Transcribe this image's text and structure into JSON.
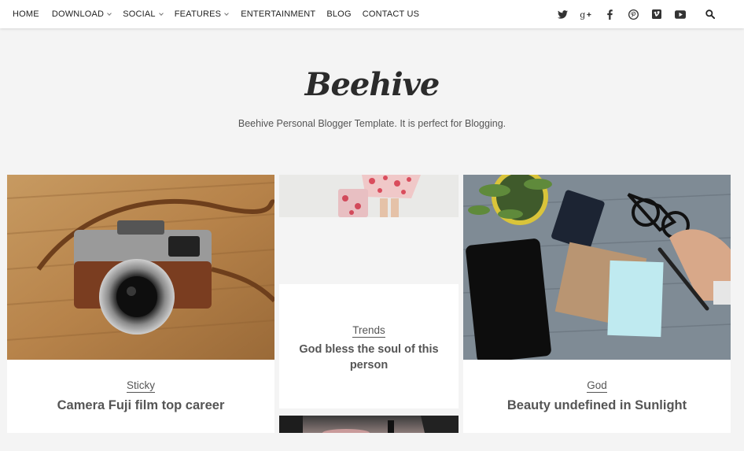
{
  "nav": {
    "items": [
      {
        "label": "HOME",
        "dropdown": false
      },
      {
        "label": "DOWNLOAD",
        "dropdown": true
      },
      {
        "label": "SOCIAL",
        "dropdown": true
      },
      {
        "label": "FEATURES",
        "dropdown": true
      },
      {
        "label": "ENTERTAINMENT",
        "dropdown": false
      },
      {
        "label": "BLOG",
        "dropdown": false
      },
      {
        "label": "CONTACT US",
        "dropdown": false
      }
    ],
    "social_icons": [
      "twitter-icon",
      "google-plus-icon",
      "facebook-icon",
      "pinterest-icon",
      "vimeo-icon",
      "youtube-icon"
    ],
    "search_icon": "search-icon"
  },
  "header": {
    "logo": "Beehive",
    "tagline": "Beehive Personal Blogger Template. It is perfect for Blogging."
  },
  "posts": [
    {
      "category": "Sticky",
      "title": "Camera Fuji film top career"
    },
    {
      "category": "Trends",
      "title": "God bless the soul of this person"
    },
    {
      "category": "God",
      "title": "Beauty undefined in Sunlight"
    }
  ],
  "colors": {
    "background": "#f4f4f4",
    "nav_background": "#ffffff",
    "text": "#555555"
  }
}
